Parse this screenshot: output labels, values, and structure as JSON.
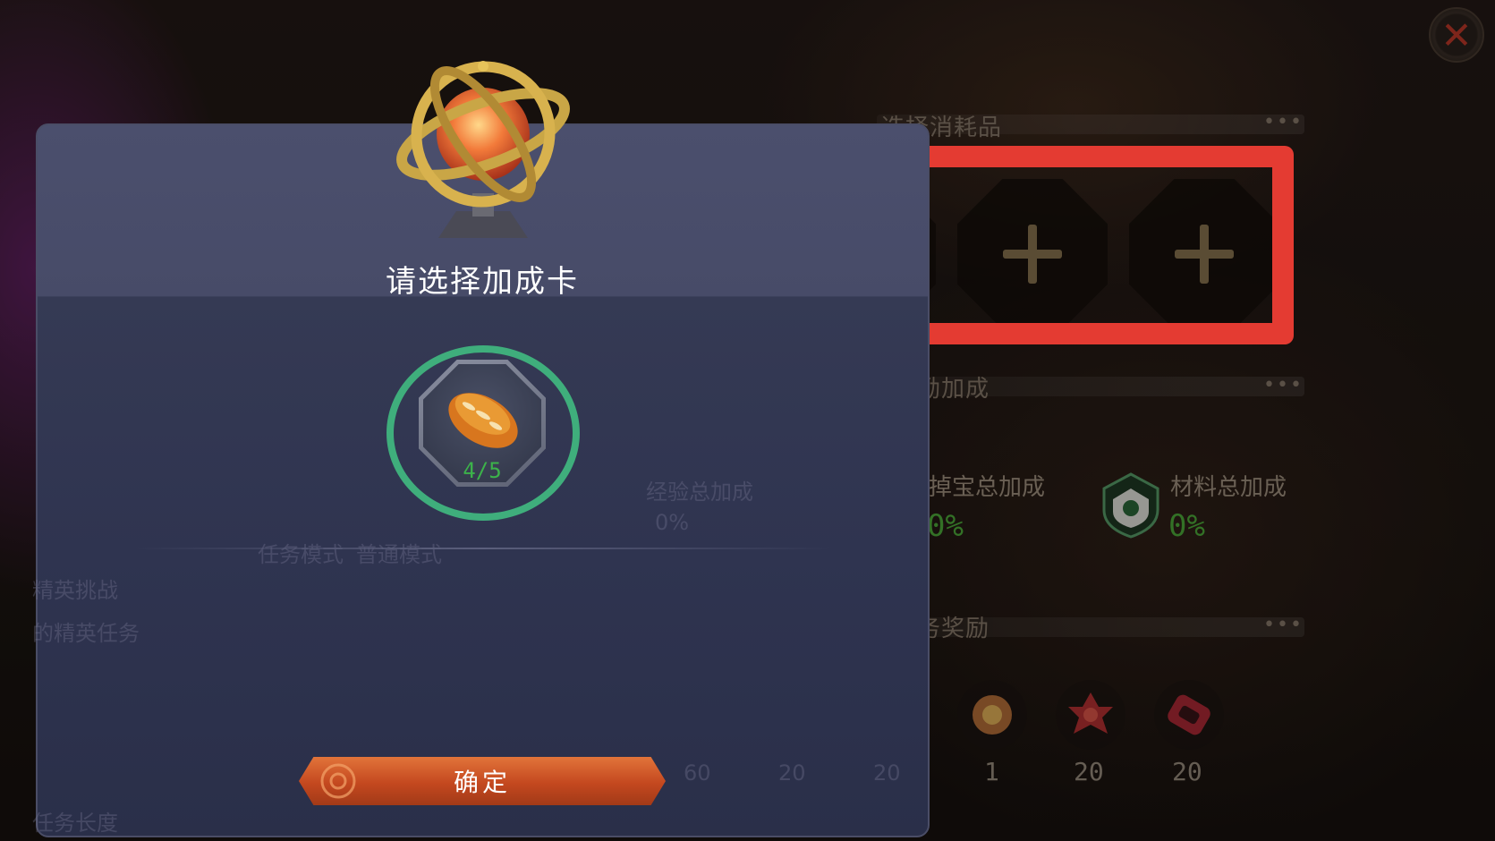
{
  "background": {
    "section_consumables": "选择消耗品",
    "section_bonus": "奖励加成",
    "section_task_reward": "任务奖励",
    "bonus_drop_label": "掉宝总加成",
    "bonus_drop_value": "0%",
    "bonus_material_label": "材料总加成",
    "bonus_material_value": "0%",
    "rewards": [
      {
        "icon": "gear-badge-icon",
        "count": "1"
      },
      {
        "icon": "red-flower-icon",
        "count": "20"
      },
      {
        "icon": "red-gem-icon",
        "count": "20"
      }
    ],
    "ghost_texts": {
      "elite": "精英挑战",
      "exp_bonus": "经验总加成",
      "task_length": "任务长度",
      "mode_a": "任务模式",
      "mode_b": "普通模式",
      "elite_task": "的精英任务",
      "num_a": "60",
      "num_b": "20",
      "num_c": "20",
      "exp_val": "0%"
    }
  },
  "modal": {
    "title": "请选择加成卡",
    "card": {
      "icon": "bread-icon",
      "count": "4/5"
    },
    "confirm_label": "确定"
  },
  "colors": {
    "highlight": "#e43b32",
    "selection_ring": "#3fae7c",
    "bonus_value": "#4fae3b",
    "confirm": "#c4481f"
  }
}
